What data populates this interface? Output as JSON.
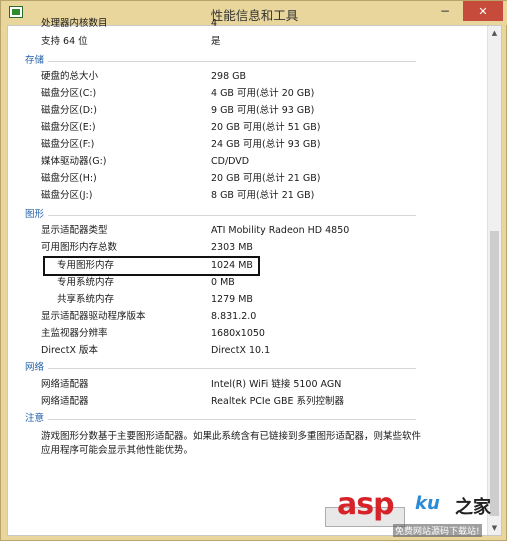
{
  "window": {
    "title": "性能信息和工具",
    "minimize_glyph": "−"
  },
  "top_rows": [
    {
      "label": "处理器内核数目",
      "value": "4"
    },
    {
      "label": "支持 64 位",
      "value": "是"
    }
  ],
  "sections": {
    "storage": {
      "title": "存储",
      "rows": [
        {
          "label": "硬盘的总大小",
          "value": "298 GB"
        },
        {
          "label": "磁盘分区(C:)",
          "value": "4 GB 可用(总计 20 GB)"
        },
        {
          "label": "磁盘分区(D:)",
          "value": "9 GB 可用(总计 93 GB)"
        },
        {
          "label": "磁盘分区(E:)",
          "value": "20 GB 可用(总计 51 GB)"
        },
        {
          "label": "磁盘分区(F:)",
          "value": "24 GB 可用(总计 93 GB)"
        },
        {
          "label": "媒体驱动器(G:)",
          "value": "CD/DVD"
        },
        {
          "label": "磁盘分区(H:)",
          "value": "20 GB 可用(总计 21 GB)"
        },
        {
          "label": "磁盘分区(J:)",
          "value": "8 GB 可用(总计 21 GB)"
        }
      ]
    },
    "graphics": {
      "title": "图形",
      "rows": [
        {
          "label": "显示适配器类型",
          "value": "ATI Mobility Radeon HD 4850"
        },
        {
          "label": "可用图形内存总数",
          "value": "2303 MB"
        },
        {
          "label": "专用图形内存",
          "value": "1024 MB"
        },
        {
          "label": "专用系统内存",
          "value": "0 MB"
        },
        {
          "label": "共享系统内存",
          "value": "1279 MB"
        },
        {
          "label": "显示适配器驱动程序版本",
          "value": "8.831.2.0"
        },
        {
          "label": "主监视器分辨率",
          "value": "1680x1050"
        },
        {
          "label": "DirectX 版本",
          "value": "DirectX 10.1"
        }
      ]
    },
    "network": {
      "title": "网络",
      "rows": [
        {
          "label": "网络适配器",
          "value": "Intel(R) WiFi 链接 5100 AGN"
        },
        {
          "label": "网络适配器",
          "value": "Realtek PCIe GBE 系列控制器"
        }
      ]
    },
    "notes": {
      "title": "注意",
      "text": "游戏图形分数基于主要图形适配器。如果此系统含有已链接到多重图形适配器，则某些软件应用程序可能会显示其他性能优势。"
    }
  },
  "watermark": {
    "main": "asp",
    "ku": "ku",
    "zhi": "之家",
    "sub": "免费网站源码下载站!"
  }
}
